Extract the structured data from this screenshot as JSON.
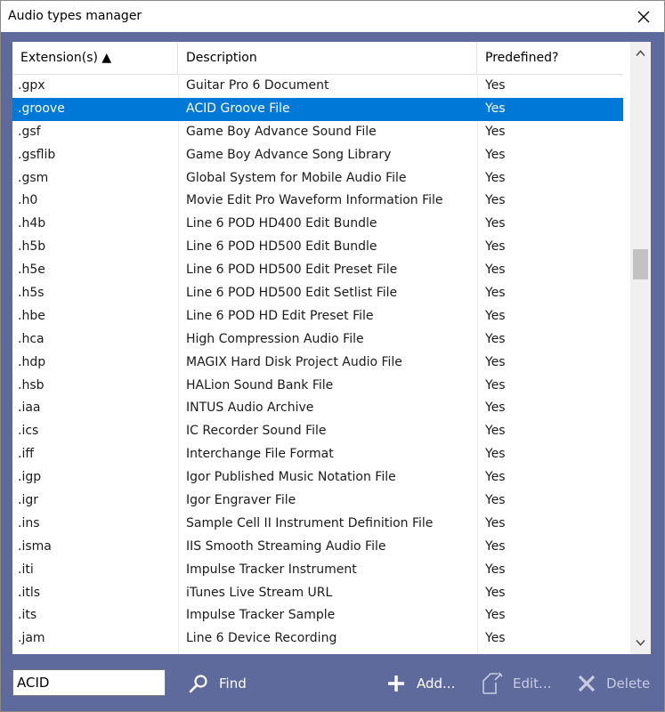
{
  "window": {
    "title": "Audio types manager"
  },
  "table": {
    "columns": [
      "Extension(s) ▲",
      "Description",
      "Predefined?"
    ],
    "selected_index": 1,
    "rows": [
      {
        "ext": ".gpx",
        "desc": "Guitar Pro 6 Document",
        "pre": "Yes"
      },
      {
        "ext": ".groove",
        "desc": "ACID Groove File",
        "pre": "Yes"
      },
      {
        "ext": ".gsf",
        "desc": "Game Boy Advance Sound File",
        "pre": "Yes"
      },
      {
        "ext": ".gsflib",
        "desc": "Game Boy Advance Song Library",
        "pre": "Yes"
      },
      {
        "ext": ".gsm",
        "desc": "Global System for Mobile Audio File",
        "pre": "Yes"
      },
      {
        "ext": ".h0",
        "desc": "Movie Edit Pro Waveform Information File",
        "pre": "Yes"
      },
      {
        "ext": ".h4b",
        "desc": "Line 6 POD HD400 Edit Bundle",
        "pre": "Yes"
      },
      {
        "ext": ".h5b",
        "desc": "Line 6 POD HD500 Edit Bundle",
        "pre": "Yes"
      },
      {
        "ext": ".h5e",
        "desc": "Line 6 POD HD500 Edit Preset File",
        "pre": "Yes"
      },
      {
        "ext": ".h5s",
        "desc": "Line 6 POD HD500 Edit Setlist File",
        "pre": "Yes"
      },
      {
        "ext": ".hbe",
        "desc": "Line 6 POD HD Edit Preset File",
        "pre": "Yes"
      },
      {
        "ext": ".hca",
        "desc": "High Compression Audio File",
        "pre": "Yes"
      },
      {
        "ext": ".hdp",
        "desc": "MAGIX Hard Disk Project Audio File",
        "pre": "Yes"
      },
      {
        "ext": ".hsb",
        "desc": "HALion Sound Bank File",
        "pre": "Yes"
      },
      {
        "ext": ".iaa",
        "desc": "INTUS Audio Archive",
        "pre": "Yes"
      },
      {
        "ext": ".ics",
        "desc": "IC Recorder Sound File",
        "pre": "Yes"
      },
      {
        "ext": ".iff",
        "desc": "Interchange File Format",
        "pre": "Yes"
      },
      {
        "ext": ".igp",
        "desc": "Igor Published Music Notation File",
        "pre": "Yes"
      },
      {
        "ext": ".igr",
        "desc": "Igor Engraver File",
        "pre": "Yes"
      },
      {
        "ext": ".ins",
        "desc": "Sample Cell II Instrument Definition File",
        "pre": "Yes"
      },
      {
        "ext": ".isma",
        "desc": "IIS Smooth Streaming Audio File",
        "pre": "Yes"
      },
      {
        "ext": ".iti",
        "desc": "Impulse Tracker Instrument",
        "pre": "Yes"
      },
      {
        "ext": ".itls",
        "desc": "iTunes Live Stream URL",
        "pre": "Yes"
      },
      {
        "ext": ".its",
        "desc": "Impulse Tracker Sample",
        "pre": "Yes"
      },
      {
        "ext": ".jam",
        "desc": "Line 6 Device Recording",
        "pre": "Yes"
      }
    ]
  },
  "footer": {
    "search_value": "ACID",
    "find_label": "Find",
    "add_label": "Add...",
    "edit_label": "Edit...",
    "delete_label": "Delete"
  },
  "colors": {
    "selection": "#0078d7",
    "panel": "#5f6a9c"
  },
  "icons": [
    "close-icon",
    "search-icon",
    "plus-icon",
    "edit-icon",
    "delete-icon",
    "chevron-up-icon",
    "chevron-down-icon"
  ]
}
